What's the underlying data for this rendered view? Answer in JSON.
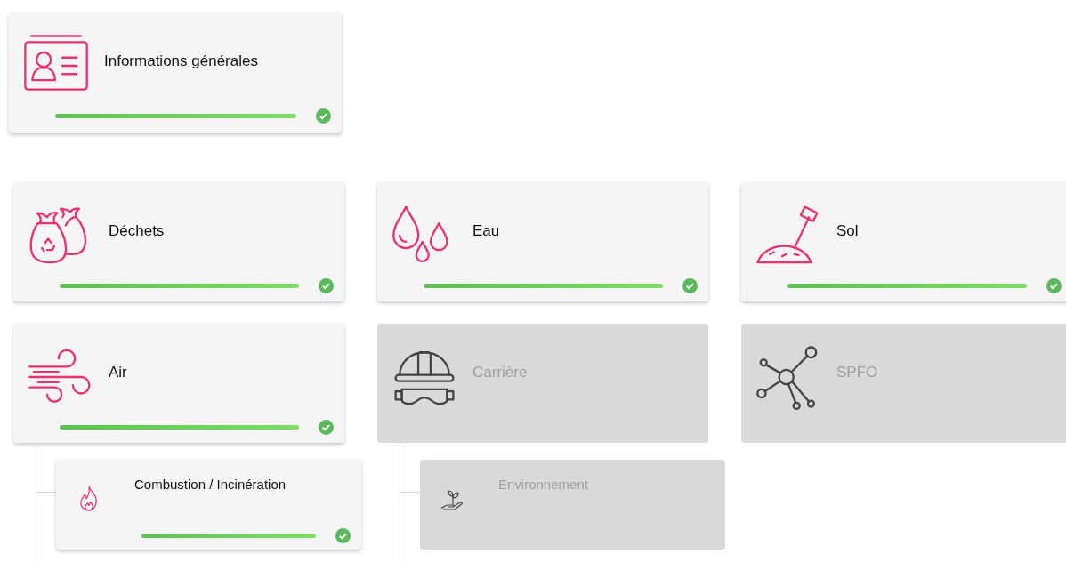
{
  "general": {
    "title": "Informations générales",
    "disabled": false,
    "complete": true
  },
  "modules": [
    {
      "title": "Déchets",
      "disabled": false,
      "complete": true
    },
    {
      "title": "Eau",
      "disabled": false,
      "complete": true
    },
    {
      "title": "Sol",
      "disabled": false,
      "complete": true
    },
    {
      "title": "Air",
      "disabled": false,
      "complete": true,
      "children": [
        {
          "title": "Combustion / Incinération",
          "disabled": false,
          "complete": true
        }
      ]
    },
    {
      "title": "Carrière",
      "disabled": true,
      "children": [
        {
          "title": "Environnement",
          "disabled": true
        }
      ]
    },
    {
      "title": "SPFO",
      "disabled": true
    }
  ]
}
